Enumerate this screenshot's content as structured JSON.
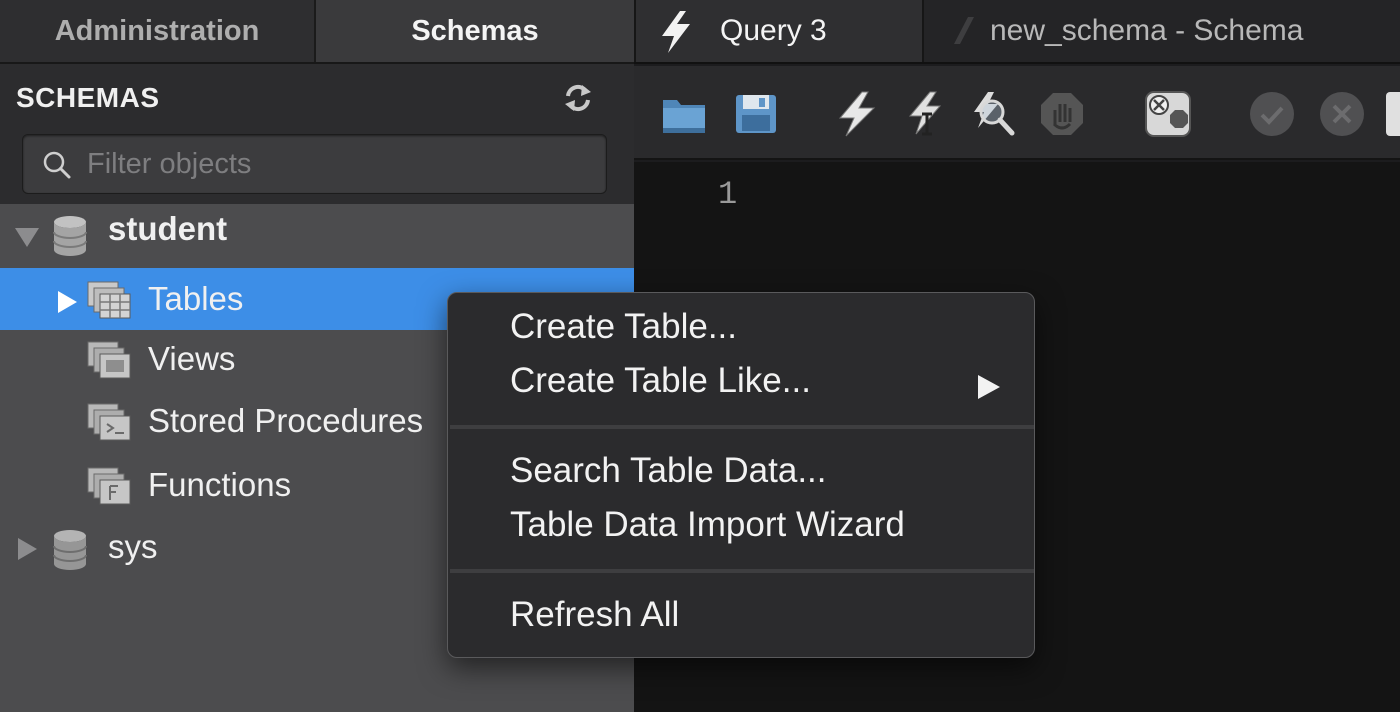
{
  "left_tabs": [
    {
      "label": "Administration",
      "active": false
    },
    {
      "label": "Schemas",
      "active": true
    }
  ],
  "schemas_panel": {
    "title": "SCHEMAS",
    "refresh_icon": "refresh-arrows-icon",
    "filter_placeholder": "Filter objects",
    "filter_value": ""
  },
  "tree": {
    "student": {
      "label": "student",
      "expanded": true
    },
    "items": [
      {
        "label": "Tables",
        "selected": true,
        "has_arrow": true
      },
      {
        "label": "Views"
      },
      {
        "label": "Stored Procedures"
      },
      {
        "label": "Functions"
      }
    ],
    "sys": {
      "label": "sys",
      "expanded": false
    }
  },
  "editor_tabs": [
    {
      "label": "Query 3",
      "icon": "lightning-icon",
      "active": true
    },
    {
      "label": "new_schema - Schema",
      "icon": "schema-icon",
      "active": false
    }
  ],
  "toolbar": {
    "buttons": [
      "open-folder-icon",
      "save-icon",
      "execute-icon",
      "execute-current-icon",
      "explain-icon",
      "stop-icon",
      "toggle-error-icon",
      "commit-icon",
      "rollback-icon"
    ]
  },
  "editor": {
    "line_numbers": [
      "1"
    ]
  },
  "context_menu": {
    "items": [
      {
        "label": "Create Table...",
        "submenu": false
      },
      {
        "label": "Create Table Like...",
        "submenu": true
      },
      {
        "label": "Search Table Data...",
        "submenu": false
      },
      {
        "label": "Table Data Import Wizard",
        "submenu": false
      },
      {
        "label": "Refresh All",
        "submenu": false
      }
    ]
  },
  "colors": {
    "selection": "#3d8ee7",
    "tree_bg": "#4c4c4e",
    "editor_bg": "#141414",
    "menu_bg": "#2b2b2d"
  }
}
